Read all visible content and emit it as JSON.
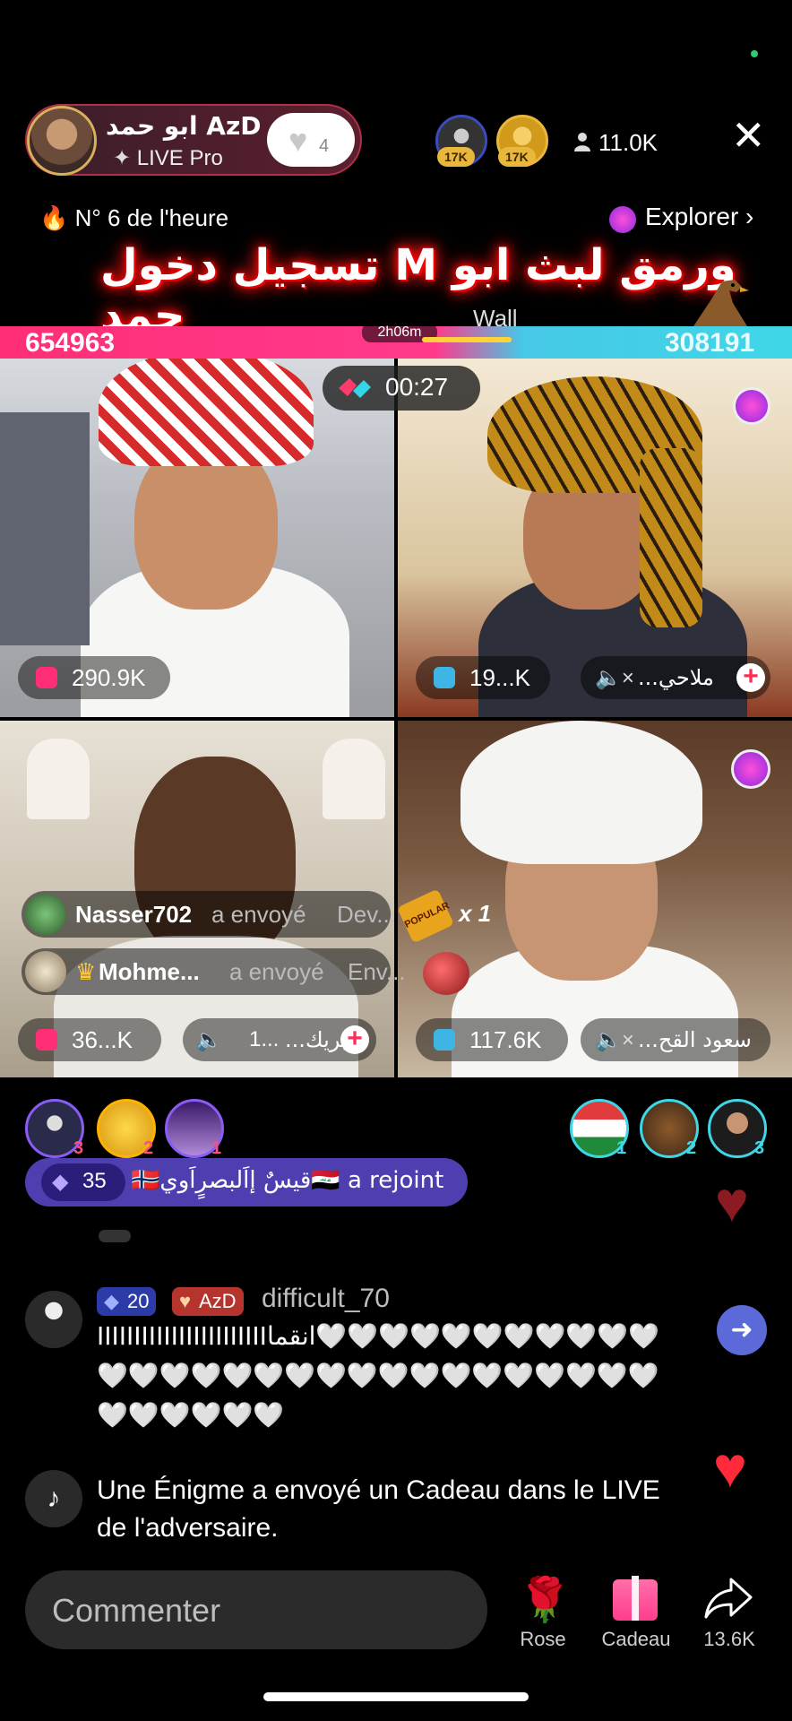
{
  "host": {
    "name": "ابو حمد AzD",
    "subtitle": "LIVE Pro",
    "follow_count": "4"
  },
  "top_viewers": [
    {
      "badge": "17K"
    },
    {
      "badge": "17K"
    }
  ],
  "viewer_count": "11.0K",
  "rank_text": "N° 6 de l'heure",
  "explore_label": "Explorer",
  "banner": {
    "text": "تسجيل دخول M ورمق لبث ابو حمد",
    "wall": "Wall"
  },
  "battle": {
    "score_left": "654963",
    "score_right": "308191",
    "left_progress": 0.68,
    "elapsed": "2h06m",
    "countdown": "00:27"
  },
  "tiles": [
    {
      "stat": "290.9K"
    },
    {
      "stat": "19...K",
      "name": "...ملاحي"
    },
    {
      "stat": "36...K",
      "name": "...بريك",
      "extra": "1..."
    },
    {
      "stat": "117.6K",
      "name": "...سعود القح"
    }
  ],
  "gifts": [
    {
      "user": "Nasser702",
      "action": "a envoyé",
      "item": "Dev..."
    },
    {
      "user": "Mohme...",
      "action": "a envoyé",
      "item": "Env..."
    }
  ],
  "popular_label": "POPULAR",
  "popular_count": "x 1",
  "left_supporters": [
    {
      "rank": "3"
    },
    {
      "rank": "2"
    },
    {
      "rank": "1"
    }
  ],
  "right_supporters": [
    {
      "rank": "1"
    },
    {
      "rank": "2"
    },
    {
      "rank": "3"
    }
  ],
  "join": {
    "gems": "35",
    "text": "🇳🇴قيسٌ إاَلبصرٍاَوي🇮🇶 a rejoint"
  },
  "comment": {
    "gem_level": "20",
    "badge": "AzD",
    "user": "difficult_70",
    "line1": "IIIIIIIIIIIIIIIIIIIIIIIانقما🤍🤍🤍🤍🤍🤍🤍🤍🤍🤍🤍",
    "line2": "🤍🤍🤍🤍🤍🤍🤍🤍🤍🤍🤍🤍🤍🤍🤍🤍🤍🤍",
    "line3": "🤍🤍🤍🤍🤍🤍"
  },
  "system_message": {
    "line1": "Une Énigme a envoyé un Cadeau dans le LIVE",
    "line2": "de l'adversaire."
  },
  "input": {
    "placeholder": "Commenter"
  },
  "actions": {
    "rose": "Rose",
    "gift": "Cadeau",
    "share_count": "13.6K"
  },
  "colors": {
    "team_left": "#ff2e77",
    "team_right": "#3fd7e8",
    "accent": "#fe2c55"
  }
}
